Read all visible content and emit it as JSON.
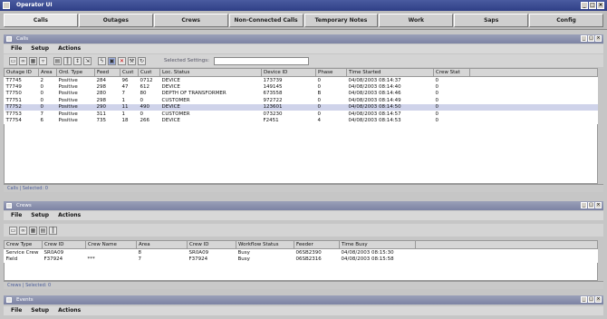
{
  "window": {
    "title": "Operator UI"
  },
  "main_tabs": [
    "Calls",
    "Outages",
    "Crews",
    "Non-Connected Calls",
    "Temporary Notes",
    "Work",
    "Saps",
    "Config"
  ],
  "panels": [
    {
      "title": "Calls",
      "menu": [
        "File",
        "Setup",
        "Actions"
      ],
      "toolbar_label": "Selected Settings:",
      "toolbar_value": "",
      "columns": [
        "Outage ID",
        "Area",
        "Ord. Type",
        "Feed",
        "Cust",
        "Cust",
        "Loc. Status",
        "Device ID",
        "Phase",
        "Time Started",
        "Crew Stat"
      ],
      "rows": [
        [
          "T7745",
          "2",
          "Positive",
          "284",
          "96",
          "0712",
          "DEVICE",
          "173739",
          "0",
          "04/08/2003 08:14:37",
          "0"
        ],
        [
          "T7749",
          "0",
          "Positive",
          "298",
          "47",
          "612",
          "DEVICE",
          "149145",
          "0",
          "04/08/2003 08:14:40",
          "0"
        ],
        [
          "T7750",
          "0",
          "Positive",
          "280",
          "7",
          "80",
          "DEPTH OF TRANSFORMER",
          "673558",
          "B",
          "04/08/2003 08:14:46",
          "0"
        ],
        [
          "T7751",
          "0",
          "Positive",
          "298",
          "1",
          "0",
          "CUSTOMER",
          "972722",
          "0",
          "04/08/2003 08:14:49",
          "0"
        ],
        [
          "T7752",
          "0",
          "Positive",
          "290",
          "11",
          "490",
          "DEVICE",
          "123601",
          "0",
          "04/08/2003 08:14:50",
          "0"
        ],
        [
          "T7753",
          "7",
          "Positive",
          "311",
          "1",
          "0",
          "CUSTOMER",
          "073230",
          "0",
          "04/08/2003 08:14:57",
          "0"
        ],
        [
          "T7754",
          "6",
          "Positive",
          "735",
          "18",
          "266",
          "DEVICE",
          "F2451",
          "4",
          "04/08/2003 08:14:53",
          "0"
        ]
      ],
      "status": "Calls | Selected: 0"
    },
    {
      "title": "Crews",
      "menu": [
        "File",
        "Setup",
        "Actions"
      ],
      "columns": [
        "Crew Type",
        "Crew ID",
        "Crew Name",
        "Area",
        "Crew ID",
        "Workflow Status",
        "Feeder",
        "Time Busy"
      ],
      "rows": [
        [
          "Service Crew",
          "SR0A09",
          "",
          "8",
          "SR0A09",
          "Busy",
          "06SB2390",
          "04/08/2003 08:15:30"
        ],
        [
          "Field",
          "F37924",
          "***",
          "7",
          "F37924",
          "Busy",
          "06SB2316",
          "04/08/2003 08:15:58"
        ]
      ],
      "status": "Crews | Selected: 0"
    },
    {
      "title": "Events",
      "menu": [
        "File",
        "Setup",
        "Actions"
      ]
    }
  ]
}
